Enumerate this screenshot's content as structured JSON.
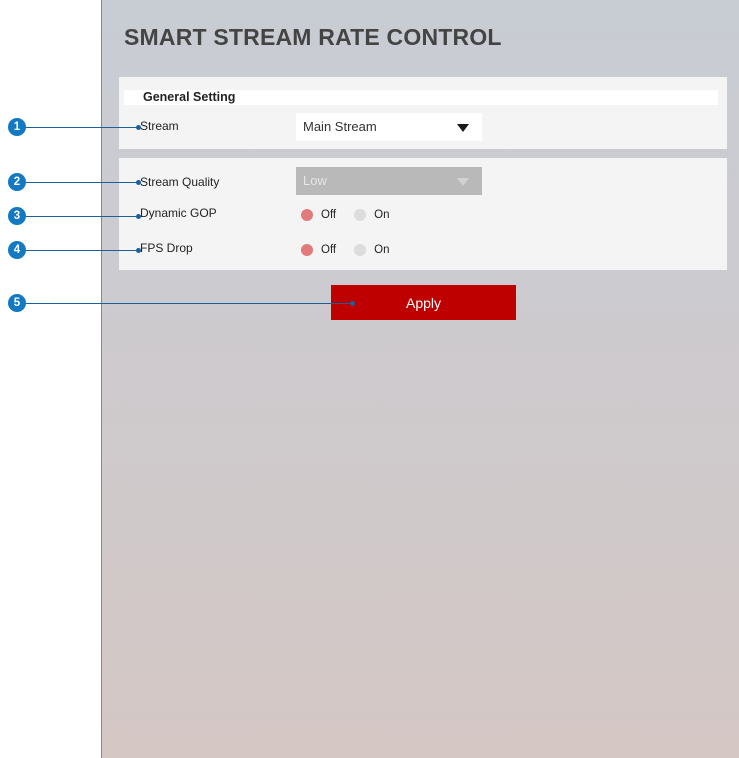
{
  "page_title": "SMART STREAM RATE CONTROL",
  "general_setting": {
    "title": "General Setting",
    "stream_label": "Stream",
    "stream_value": "Main Stream"
  },
  "settings": {
    "stream_quality_label": "Stream Quality",
    "stream_quality_value": "Low",
    "dynamic_gop_label": "Dynamic GOP",
    "fps_drop_label": "FPS Drop",
    "off_label": "Off",
    "on_label": "On"
  },
  "apply_label": "Apply",
  "callouts": [
    "1",
    "2",
    "3",
    "4",
    "5"
  ],
  "colors": {
    "accent": "#bf0000",
    "callout": "#1279c2",
    "radio_selected": "#e07b7b"
  }
}
